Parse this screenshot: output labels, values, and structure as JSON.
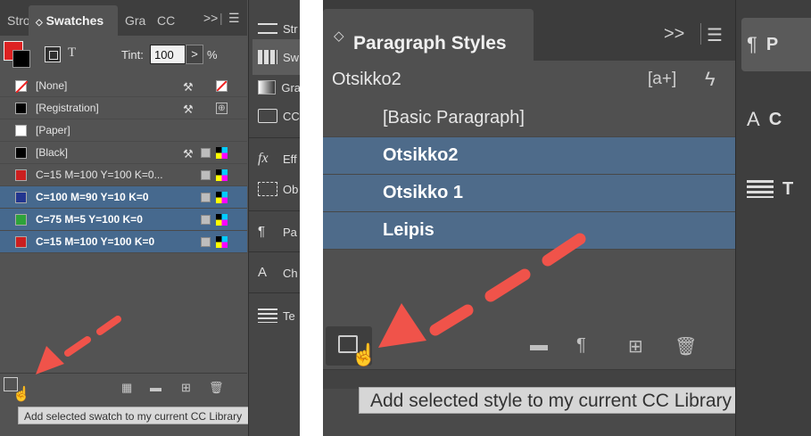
{
  "left_panel": {
    "tabs": {
      "stroke": "Stro",
      "swatches": "Swatches",
      "gradient": "Gra",
      "cc": "CC",
      "more": ">>"
    },
    "tint_label": "Tint:",
    "tint_value": "100",
    "tint_btn": ">",
    "tint_unit": "%",
    "swatches": [
      {
        "name": "[None]",
        "color": "#ffffff"
      },
      {
        "name": "[Registration]",
        "color": "#000000"
      },
      {
        "name": "[Paper]",
        "color": "#ffffff"
      },
      {
        "name": "[Black]",
        "color": "#000000"
      },
      {
        "name": "C=15 M=100 Y=100 K=0...",
        "color": "#cc1f1f"
      },
      {
        "name": "C=100 M=90 Y=10 K=0",
        "color": "#23368f"
      },
      {
        "name": "C=75 M=5 Y=100 K=0",
        "color": "#2ea33a"
      },
      {
        "name": "C=15 M=100 Y=100 K=0",
        "color": "#cc1f1f"
      }
    ],
    "tooltip": "Add selected swatch to my current CC Library",
    "side_items": [
      "Str",
      "Sw",
      "Gra",
      "CC",
      "Eff",
      "Ob",
      "Pa",
      "Ch",
      "Te"
    ]
  },
  "right_panel": {
    "title": "Paragraph Styles",
    "more": ">>",
    "current_style": "Otsikko2",
    "new_style_btn": "[a+]",
    "styles": [
      {
        "name": "[Basic Paragraph]"
      },
      {
        "name": "Otsikko2"
      },
      {
        "name": "Otsikko 1"
      },
      {
        "name": "Leipis"
      }
    ],
    "tooltip": "Add selected style to my current CC Library",
    "side_items": [
      "P",
      "C",
      "T"
    ]
  },
  "colors": {
    "arrow": "#f0534a",
    "selection_left": "#46698e",
    "selection_right": "#4e6b8a"
  }
}
